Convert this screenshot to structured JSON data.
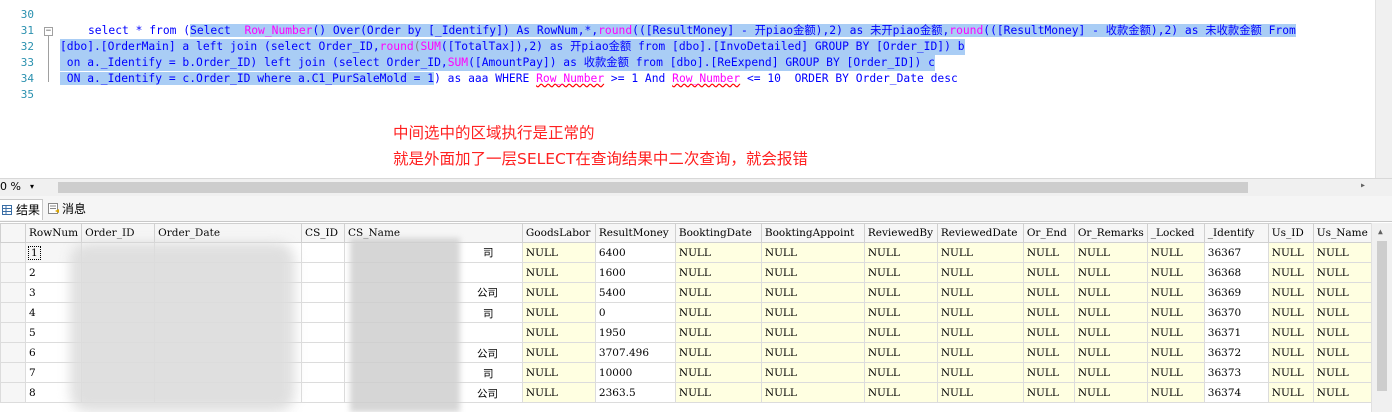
{
  "editor": {
    "line_numbers": [
      "30",
      "31",
      "32",
      "33",
      "34",
      "35"
    ],
    "lines": {
      "l31": {
        "a": "select * from (",
        "b": "Select  ",
        "c": "Row_Number",
        "d": "() Over(Order by [_Identify]) As RowNum,*,",
        "e": "round",
        "f": "(([ResultMoney] - 开piao金额),2) as 未开piao金额,",
        "g": "round",
        "h": "(([ResultMoney] - 收款金额),2) as 未收款金额 From"
      },
      "l32": {
        "a": "[dbo].[OrderMain] a left join (select Order_ID,",
        "b": "round",
        "c": "(",
        "d": "SUM",
        "e": "([TotalTax]),2) as 开piao金额 from [dbo].[InvoDetailed] GROUP BY [Order_ID]) b"
      },
      "l33": {
        "a": " on a._Identify = b.Order_ID) left join (select Order_ID,",
        "b": "SUM",
        "c": "([AmountPay]) as 收款金额 from [dbo].[ReExpend] GROUP BY [Order_ID]) c"
      },
      "l34": {
        "a": " ON a._Identify = c.Order_ID where a.C1_PurSaleMold = 1",
        "b": ") as aaa WHERE ",
        "c": "Row_Number",
        "d": " >= 1 And ",
        "e": "Row_Number",
        "f": " <= 10  ORDER BY Order_Date desc"
      }
    },
    "annotation_line1": "中间选中的区域执行是正常的",
    "annotation_line2": "就是外面加了一层SELECT在查询结果中二次查询，就会报错"
  },
  "zoom": {
    "value": "0 %",
    "arrow": "▾"
  },
  "tabs": [
    {
      "label": "结果",
      "icon": "grid-icon"
    },
    {
      "label": "消息",
      "icon": "message-icon"
    }
  ],
  "grid": {
    "columns": [
      "RowNum",
      "Order_ID",
      "Order_Date",
      "CS_ID",
      "CS_Name",
      "GoodsLabor",
      "ResultMoney",
      "BooktingDate",
      "BooktingAppoint",
      "ReviewedBy",
      "ReviewedDate",
      "Or_End",
      "Or_Remarks",
      "_Locked",
      "_Identify",
      "Us_ID",
      "Us_Name"
    ],
    "rows": [
      {
        "rownum": "1",
        "result": "6400",
        "identify": "36367"
      },
      {
        "rownum": "2",
        "result": "1600",
        "identify": "36368"
      },
      {
        "rownum": "3",
        "result": "5400",
        "identify": "36369"
      },
      {
        "rownum": "4",
        "result": "0",
        "identify": "36370"
      },
      {
        "rownum": "5",
        "result": "1950",
        "identify": "36371"
      },
      {
        "rownum": "6",
        "result": "3707.496",
        "identify": "36372"
      },
      {
        "rownum": "7",
        "result": "10000",
        "identify": "36373"
      },
      {
        "rownum": "8",
        "result": "2363.5",
        "identify": "36374"
      }
    ],
    "null_text": "NULL",
    "name_fragments": [
      "司",
      "司",
      "公司",
      "公司",
      "司",
      "公司"
    ]
  },
  "colors": {
    "selection": "#a9cdf5",
    "keyword": "#0000ff",
    "function": "#ff00ff",
    "annotation": "#ff2020",
    "null_cell": "#ffffe1"
  }
}
